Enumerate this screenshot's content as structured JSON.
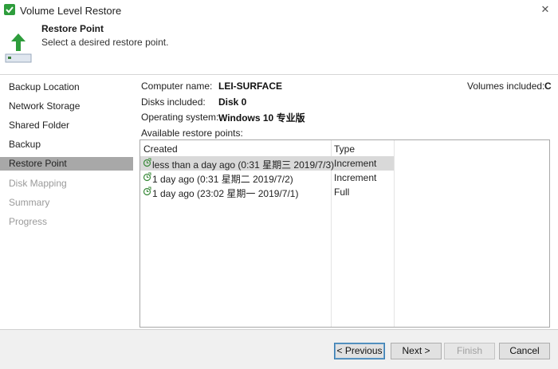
{
  "window": {
    "title": "Volume Level Restore",
    "close_glyph": "✕"
  },
  "header": {
    "title": "Restore Point",
    "subtitle": "Select a desired restore point.",
    "icon": "restore-arrow-icon"
  },
  "sidebar": {
    "items": [
      {
        "label": "Backup Location",
        "state": "normal"
      },
      {
        "label": "Network Storage",
        "state": "normal"
      },
      {
        "label": "Shared Folder",
        "state": "normal"
      },
      {
        "label": "Backup",
        "state": "normal"
      },
      {
        "label": "Restore Point",
        "state": "active"
      },
      {
        "label": "Disk Mapping",
        "state": "disabled"
      },
      {
        "label": "Summary",
        "state": "disabled"
      },
      {
        "label": "Progress",
        "state": "disabled"
      }
    ]
  },
  "info": {
    "computer_label": "Computer name:",
    "computer_value": "LEI-SURFACE",
    "disks_label": "Disks included:",
    "disks_value": "Disk 0",
    "os_label": "Operating system:",
    "os_value": "Windows 10 专业版",
    "volumes_label": "Volumes included:",
    "volumes_value": "C",
    "available_label": "Available restore points:"
  },
  "table": {
    "columns": [
      "Created",
      "Type"
    ],
    "rows": [
      {
        "created": "less than a day ago (0:31 星期三 2019/7/3)",
        "type": "Increment",
        "selected": true
      },
      {
        "created": "1 day ago (0:31 星期二 2019/7/2)",
        "type": "Increment",
        "selected": false
      },
      {
        "created": "1 day ago (23:02 星期一 2019/7/1)",
        "type": "Full",
        "selected": false
      }
    ],
    "row_icon": "restore-point-icon"
  },
  "buttons": {
    "previous": "< Previous",
    "next": "Next >",
    "finish": "Finish",
    "cancel": "Cancel"
  },
  "colors": {
    "accent_green": "#2e9d3c",
    "selected_sidebar": "#a8a8a8",
    "selected_row": "#d9d9d9"
  }
}
